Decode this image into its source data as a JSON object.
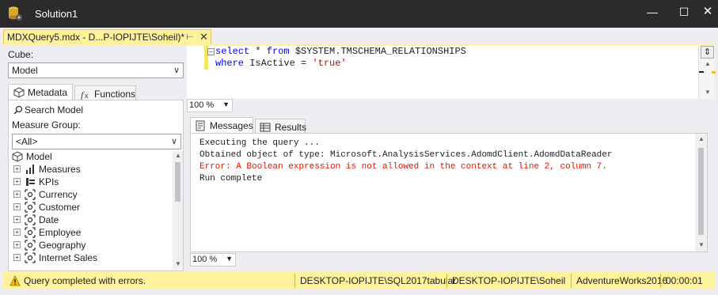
{
  "window": {
    "title": "Solution1"
  },
  "doc_tab": {
    "label": "MDXQuery5.mdx - D...P-IOPIJTE\\Soheil)*"
  },
  "left_panel": {
    "cube_label": "Cube:",
    "cube_value": "Model",
    "tabs": {
      "metadata": "Metadata",
      "functions": "Functions"
    },
    "search_label": "Search Model",
    "measure_group_label": "Measure Group:",
    "measure_group_value": "<All>",
    "tree": {
      "root": "Model",
      "items": [
        "Measures",
        "KPIs",
        "Currency",
        "Customer",
        "Date",
        "Employee",
        "Geography",
        "Internet Sales"
      ]
    }
  },
  "editor": {
    "line1": {
      "kw1": "select",
      "mid1": " * ",
      "kw2": "from",
      "rest": " $SYSTEM.TMSCHEMA_RELATIONSHIPS"
    },
    "line2": {
      "kw1": "where",
      "mid": " IsActive = ",
      "str": "'true'"
    },
    "zoom": "100 %"
  },
  "results": {
    "tabs": {
      "messages": "Messages",
      "results": "Results"
    },
    "messages": [
      "Executing the query ...",
      "Obtained object of type: Microsoft.AnalysisServices.AdomdClient.AdomdDataReader",
      "Error: A Boolean expression is not allowed in the context at line 2, column 7.",
      "Run complete"
    ],
    "zoom": "100 %"
  },
  "status": {
    "message": "Query completed with errors.",
    "server": "DESKTOP-IOPIJTE\\SQL2017tabular",
    "user": "DESKTOP-IOPIJTE\\Soheil",
    "database": "AdventureWorks2016",
    "elapsed": "00:00:01"
  },
  "colors": {
    "accent": "#fff29d",
    "error": "#e51400",
    "keyword": "#0000ff",
    "string": "#a31515"
  }
}
